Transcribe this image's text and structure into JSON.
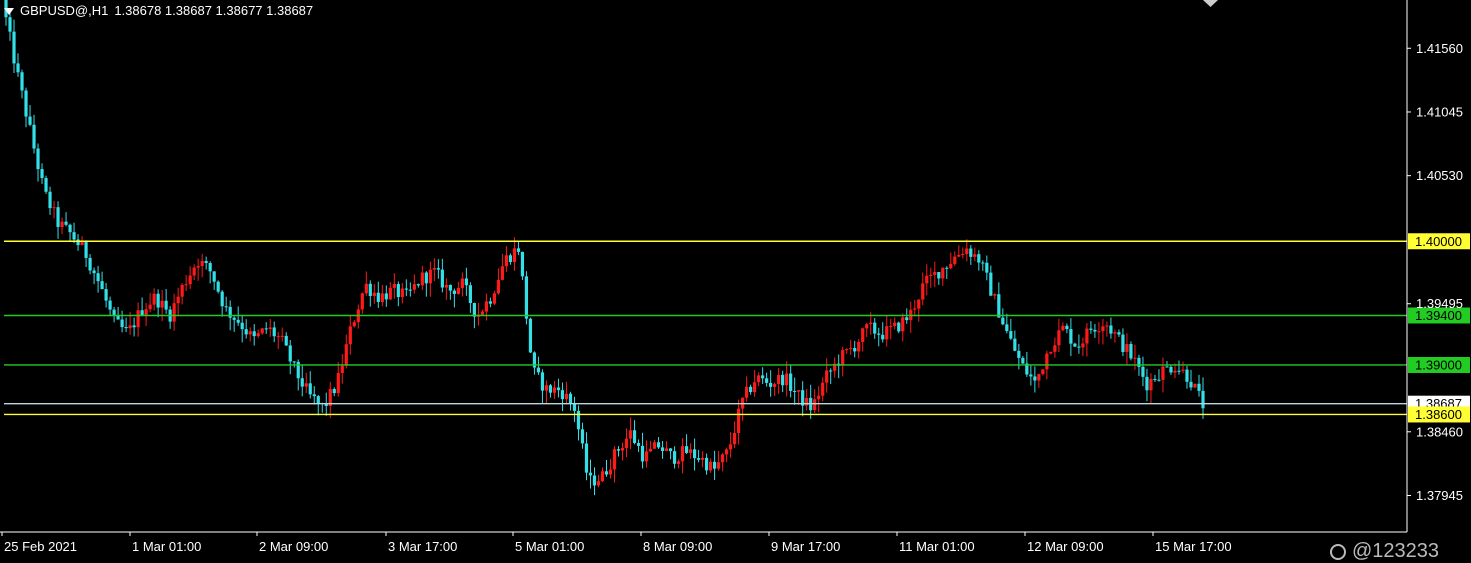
{
  "header": {
    "symbol": "GBPUSD@,H1",
    "ohlc": "1.38678 1.38687 1.38677 1.38687"
  },
  "watermark": "@123233",
  "colors": {
    "background": "#000000",
    "bull": "#ff1a1a",
    "bear": "#33e0e8",
    "grid_axis": "#ffffff",
    "level_yellow": "#ffff33",
    "level_green": "#22cc22",
    "level_current": "#b8d8e0"
  },
  "chart_data": {
    "type": "candlestick",
    "timeframe": "H1",
    "ylim": [
      1.3765,
      1.4195
    ],
    "y_ticks": [
      "1.41560",
      "1.41045",
      "1.40530",
      "1.39495",
      "1.38460",
      "1.37945"
    ],
    "x_ticks": [
      "25 Feb 2021",
      "1 Mar 01:00",
      "2 Mar 09:00",
      "3 Mar 17:00",
      "5 Mar 01:00",
      "8 Mar 09:00",
      "9 Mar 17:00",
      "11 Mar 01:00",
      "12 Mar 09:00",
      "15 Mar 17:00"
    ],
    "price_levels": [
      {
        "label": "1.40000",
        "value": 1.4,
        "color": "#ffff33",
        "box": "#ffff33",
        "text": "#000000"
      },
      {
        "label": "1.39400",
        "value": 1.394,
        "color": "#22cc22",
        "box": "#22cc22",
        "text": "#000000"
      },
      {
        "label": "1.39000",
        "value": 1.39,
        "color": "#22cc22",
        "box": "#22cc22",
        "text": "#000000"
      },
      {
        "label": "1.38687",
        "value": 1.38687,
        "color": "#b8d8e0",
        "box": "#ffffff",
        "text": "#000000"
      },
      {
        "label": "1.38600",
        "value": 1.386,
        "color": "#ffff33",
        "box": "#ffff33",
        "text": "#000000"
      }
    ],
    "close_path": [
      1.4195,
      1.414,
      1.409,
      1.404,
      1.4015,
      1.4005,
      1.399,
      1.3965,
      1.3935,
      1.3925,
      1.3945,
      1.3955,
      1.394,
      1.3965,
      1.3985,
      1.3975,
      1.3945,
      1.3935,
      1.392,
      1.393,
      1.392,
      1.3895,
      1.3875,
      1.3865,
      1.3885,
      1.393,
      1.3965,
      1.3955,
      1.396,
      1.3955,
      1.397,
      1.3975,
      1.396,
      1.3965,
      1.394,
      1.3955,
      1.3985,
      1.3995,
      1.3895,
      1.388,
      1.388,
      1.3865,
      1.3805,
      1.381,
      1.383,
      1.3845,
      1.3825,
      1.3835,
      1.3825,
      1.383,
      1.3825,
      1.3815,
      1.383,
      1.387,
      1.389,
      1.3885,
      1.389,
      1.3875,
      1.3865,
      1.389,
      1.3905,
      1.3915,
      1.393,
      1.3925,
      1.393,
      1.394,
      1.3965,
      1.3975,
      1.3985,
      1.3995,
      1.3985,
      1.3955,
      1.3925,
      1.39,
      1.3885,
      1.3915,
      1.393,
      1.3915,
      1.393,
      1.3935,
      1.392,
      1.3905,
      1.3885,
      1.3895,
      1.39,
      1.389,
      1.3868
    ]
  }
}
